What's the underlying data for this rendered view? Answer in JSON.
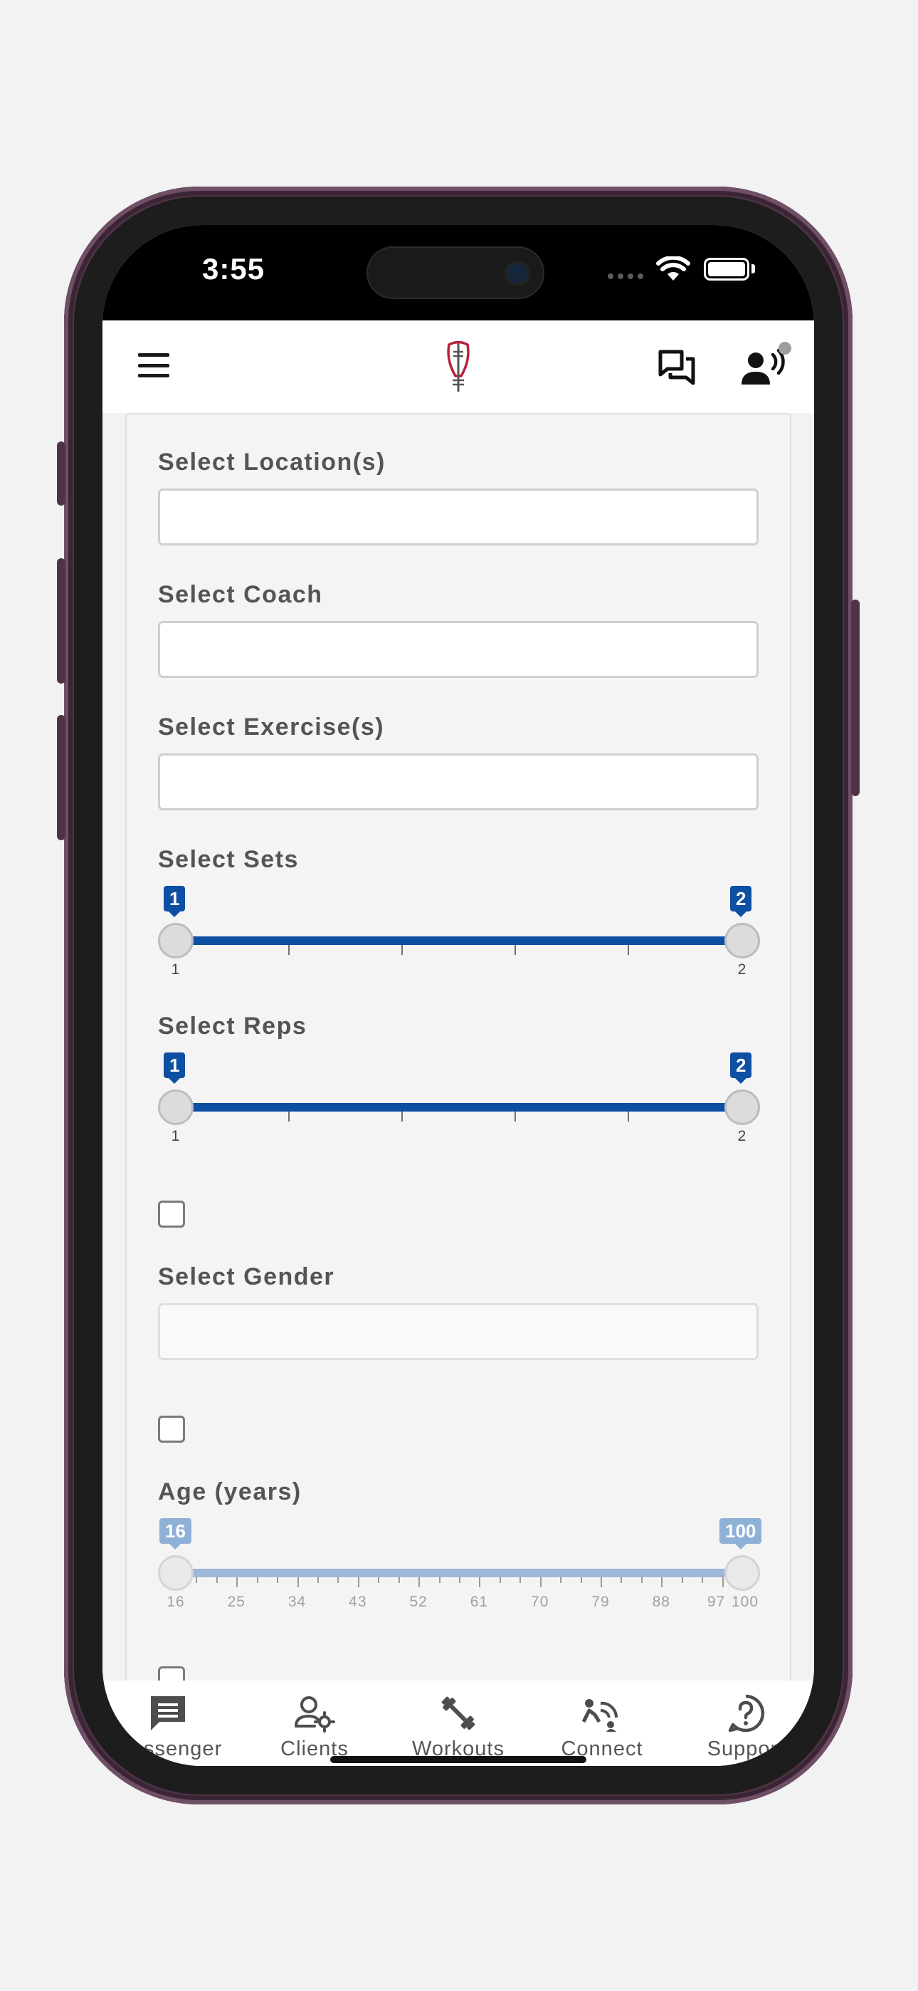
{
  "status_bar": {
    "time": "3:55"
  },
  "header": {
    "menu_icon": "hamburger-icon",
    "logo_icon": "tuning-fork-logo",
    "messages_icon": "chat-bubbles-icon",
    "coach_icon": "person-voice-icon"
  },
  "form": {
    "location_label": "Select Location(s)",
    "coach_label": "Select Coach",
    "exercise_label": "Select Exercise(s)",
    "sets": {
      "label": "Select Sets",
      "min_value": "1",
      "max_value": "2",
      "tick_min": "1",
      "tick_max": "2"
    },
    "reps": {
      "label": "Select Reps",
      "min_value": "1",
      "max_value": "2",
      "tick_min": "1",
      "tick_max": "2"
    },
    "gender_label": "Select Gender",
    "age": {
      "label": "Age (years)",
      "min_value": "16",
      "max_value": "100",
      "ticks": [
        "16",
        "25",
        "34",
        "43",
        "52",
        "61",
        "70",
        "79",
        "88",
        "97",
        "100"
      ]
    }
  },
  "bottom_nav": {
    "items": [
      {
        "label": "Messenger",
        "icon": "message-square-icon"
      },
      {
        "label": "Clients",
        "icon": "user-gear-icon"
      },
      {
        "label": "Workouts",
        "icon": "dumbbell-icon"
      },
      {
        "label": "Connect",
        "icon": "person-signal-icon"
      },
      {
        "label": "Support",
        "icon": "help-circle-icon"
      }
    ]
  },
  "colors": {
    "accent": "#0d4fa3",
    "accent_muted": "#8fb0d7",
    "logo": "#b8203a"
  }
}
